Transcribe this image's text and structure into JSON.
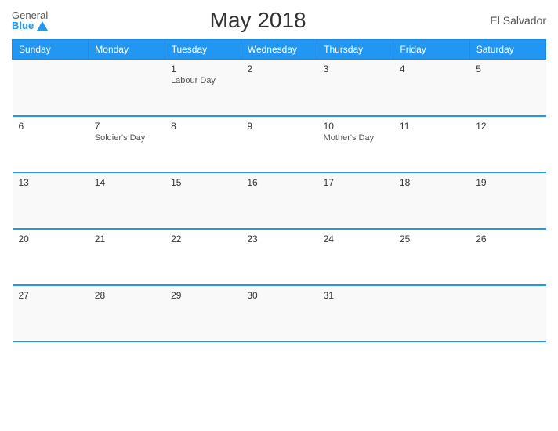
{
  "header": {
    "logo_general": "General",
    "logo_blue": "Blue",
    "title": "May 2018",
    "country": "El Salvador"
  },
  "days": {
    "headers": [
      "Sunday",
      "Monday",
      "Tuesday",
      "Wednesday",
      "Thursday",
      "Friday",
      "Saturday"
    ]
  },
  "weeks": [
    {
      "cells": [
        {
          "day": "",
          "holiday": ""
        },
        {
          "day": "",
          "holiday": ""
        },
        {
          "day": "1",
          "holiday": "Labour Day"
        },
        {
          "day": "2",
          "holiday": ""
        },
        {
          "day": "3",
          "holiday": ""
        },
        {
          "day": "4",
          "holiday": ""
        },
        {
          "day": "5",
          "holiday": ""
        }
      ]
    },
    {
      "cells": [
        {
          "day": "6",
          "holiday": ""
        },
        {
          "day": "7",
          "holiday": "Soldier's Day"
        },
        {
          "day": "8",
          "holiday": ""
        },
        {
          "day": "9",
          "holiday": ""
        },
        {
          "day": "10",
          "holiday": "Mother's Day"
        },
        {
          "day": "11",
          "holiday": ""
        },
        {
          "day": "12",
          "holiday": ""
        }
      ]
    },
    {
      "cells": [
        {
          "day": "13",
          "holiday": ""
        },
        {
          "day": "14",
          "holiday": ""
        },
        {
          "day": "15",
          "holiday": ""
        },
        {
          "day": "16",
          "holiday": ""
        },
        {
          "day": "17",
          "holiday": ""
        },
        {
          "day": "18",
          "holiday": ""
        },
        {
          "day": "19",
          "holiday": ""
        }
      ]
    },
    {
      "cells": [
        {
          "day": "20",
          "holiday": ""
        },
        {
          "day": "21",
          "holiday": ""
        },
        {
          "day": "22",
          "holiday": ""
        },
        {
          "day": "23",
          "holiday": ""
        },
        {
          "day": "24",
          "holiday": ""
        },
        {
          "day": "25",
          "holiday": ""
        },
        {
          "day": "26",
          "holiday": ""
        }
      ]
    },
    {
      "cells": [
        {
          "day": "27",
          "holiday": ""
        },
        {
          "day": "28",
          "holiday": ""
        },
        {
          "day": "29",
          "holiday": ""
        },
        {
          "day": "30",
          "holiday": ""
        },
        {
          "day": "31",
          "holiday": ""
        },
        {
          "day": "",
          "holiday": ""
        },
        {
          "day": "",
          "holiday": ""
        }
      ]
    }
  ]
}
